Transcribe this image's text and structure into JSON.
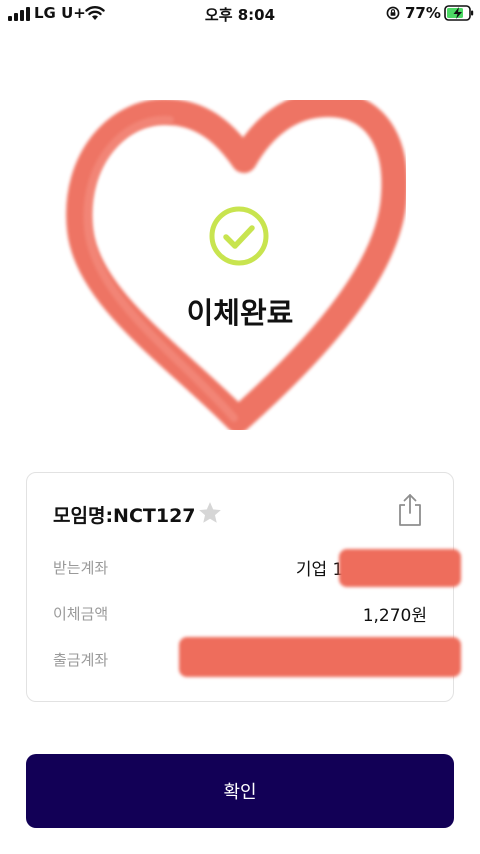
{
  "status_bar": {
    "carrier": "LG U+",
    "time": "오후 8:04",
    "battery_percent": "77%"
  },
  "result": {
    "title": "이체완료",
    "accent_color": "#c8e44f",
    "heart_color": "#ee6d5c"
  },
  "details": {
    "group_name": "모임명:NCT127",
    "rows": [
      {
        "label": "받는계좌",
        "value": "기업 127"
      },
      {
        "label": "이체금액",
        "value": "1,270원"
      },
      {
        "label": "출금계좌",
        "value": ""
      }
    ]
  },
  "actions": {
    "confirm_label": "확인",
    "confirm_color": "#120056"
  }
}
